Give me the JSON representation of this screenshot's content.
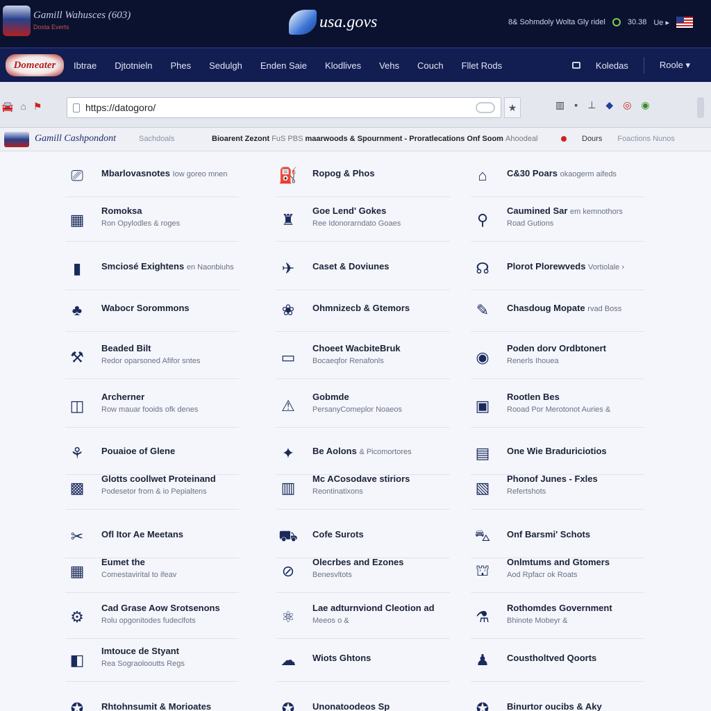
{
  "header": {
    "site_name": "Gamill Wahusces (603)",
    "site_tag": "Dosta Everts",
    "logo_text": "usa.govs",
    "utility_text": "8& Sohmdoly Wolta Gly ridel",
    "time": "30.38",
    "utility_link": "Ue ▸"
  },
  "nav": {
    "logo_text": "Domeater",
    "items": [
      "Ibtrae",
      "Djtotnieln",
      "Phes",
      "Sedulgh",
      "Enden Saie",
      "Klodlives",
      "Vehs",
      "Couch",
      "Fllet Rods"
    ],
    "right_items": [
      "Koledas",
      "Roole ▾"
    ]
  },
  "toolbar": {
    "url": "https://datogoro/",
    "icons": [
      "car-icon",
      "home-icon",
      "flag-icon"
    ],
    "extension_icons": [
      "bars-icon",
      "box-icon",
      "tower-icon",
      "badge-icon",
      "target-icon",
      "globe-icon"
    ]
  },
  "strip": {
    "brand": "Gamill Cashpondont",
    "brand_sub": "Sachdoals",
    "crumb_main": "Bioarent Zezont",
    "crumb_light": "FuS PBS",
    "crumb_rest": "maarwoods & Spournment -",
    "crumb_tail": "Proratlecations Onf Soom",
    "crumb_tail_light": "Ahoodeal",
    "right_label": "Dours",
    "right_light": "Foactions Nunos"
  },
  "entries": [
    {
      "icon": "⎚",
      "title": "Mbarlovasnotes",
      "title_sm": "Iow goreo mnen",
      "sub": ""
    },
    {
      "icon": "⛽",
      "title": "Ropog & Phos",
      "title_sm": "",
      "sub": ""
    },
    {
      "icon": "⌂",
      "title": "C&30 Poars",
      "title_sm": "okaogerm aifeds",
      "sub": ""
    },
    {
      "icon": "▦",
      "title": "Romoksa",
      "title_sm": "",
      "sub": "Ron Opylodles & roges"
    },
    {
      "icon": "♜",
      "title": "Goe Lend' Gokes",
      "title_sm": "",
      "sub": "Ree Idonorarndato Goaes"
    },
    {
      "icon": "⚲",
      "title": "Caumined Sar",
      "title_sm": "em kemnothors",
      "sub": "Road Gutions"
    },
    {
      "icon": "▮",
      "title": "Smciosé Exightens",
      "title_sm": "en Naonbiuhs",
      "sub": ""
    },
    {
      "icon": "✈",
      "title": "Caset & Doviunes",
      "title_sm": "",
      "sub": ""
    },
    {
      "icon": "☊",
      "title": "Plorot Plorewveds",
      "title_sm": "Vortiolale ›",
      "sub": ""
    },
    {
      "icon": "♣",
      "title": "Wabocr Sorommons",
      "title_sm": "",
      "sub": ""
    },
    {
      "icon": "❀",
      "title": "Ohmnizecb & Gtemors",
      "title_sm": "",
      "sub": ""
    },
    {
      "icon": "✎",
      "title": "Chasdoug Mopate",
      "title_sm": "rvad Boss",
      "sub": ""
    },
    {
      "icon": "⚒",
      "title": "Beaded Bilt",
      "title_sm": "",
      "sub": "Redor oparsoned Afifor sntes"
    },
    {
      "icon": "▭",
      "title": "Choeet WacbiteBruk",
      "title_sm": "",
      "sub": "Bocaeqfor Renafonls"
    },
    {
      "icon": "◉",
      "title": "Poden dorv Ordbtonert",
      "title_sm": "",
      "sub": "Renerls Ihouea"
    },
    {
      "icon": "◫",
      "title": "Archerner",
      "title_sm": "",
      "sub": "Row mauar fooids ofk denes"
    },
    {
      "icon": "⚠",
      "title": "Gobmde",
      "title_sm": "",
      "sub": "PersanyComeplor Noaeos"
    },
    {
      "icon": "▣",
      "title": "Rootlen Bes",
      "title_sm": "",
      "sub": "Rooad Por Merotonot Auries &"
    },
    {
      "icon": "⚘",
      "title": "Pouaioe of Glene",
      "title_sm": "",
      "sub": ""
    },
    {
      "icon": "✦",
      "title": "Be Aolons",
      "title_sm": "& Picomortores",
      "sub": ""
    },
    {
      "icon": "▤",
      "title": "One Wie Braduriciotios",
      "title_sm": "",
      "sub": ""
    },
    {
      "icon": "▩",
      "title": "Glotts coollwet Proteinand",
      "title_sm": "",
      "sub": "Podesetor from & io Pepialtens"
    },
    {
      "icon": "▥",
      "title": "Mc ACosodave stiriors",
      "title_sm": "",
      "sub": "Reontinatixons"
    },
    {
      "icon": "▧",
      "title": "Phonof Junes - Fxles",
      "title_sm": "",
      "sub": "Refertshots"
    },
    {
      "icon": "✂",
      "title": "Ofl Itor Ae Meetans",
      "title_sm": "",
      "sub": ""
    },
    {
      "icon": "⛟",
      "title": "Cofe Surots",
      "title_sm": "",
      "sub": ""
    },
    {
      "icon": "⛍",
      "title": "Onf Barsmi' Schots",
      "title_sm": "",
      "sub": ""
    },
    {
      "icon": "▦",
      "title": "Eumet the",
      "title_sm": "",
      "sub": "Comestavirital to ifeav"
    },
    {
      "icon": "⊘",
      "title": "Olecrbes and Ezones",
      "title_sm": "",
      "sub": "Benesvltots"
    },
    {
      "icon": "⛫",
      "title": "Onlmtums and Gtomers",
      "title_sm": "",
      "sub": "Aod Rpfacr ok Roats"
    },
    {
      "icon": "⚙",
      "title": "Cad Grase Aow Srotsenons",
      "title_sm": "",
      "sub": "Rolu opgonitodes fudeclfots"
    },
    {
      "icon": "⚛",
      "title": "Lae adturnviond Cleotion ad",
      "title_sm": "",
      "sub": "Meeos o &"
    },
    {
      "icon": "⚗",
      "title": "Rothomdes Government",
      "title_sm": "",
      "sub": "Bhinote Mobeyr &"
    },
    {
      "icon": "◧",
      "title": "Imtouce de Styant",
      "title_sm": "",
      "sub": "Rea Sograolooutts Regs"
    },
    {
      "icon": "☁",
      "title": "Wiots Ghtons",
      "title_sm": "",
      "sub": ""
    },
    {
      "icon": "♟",
      "title": "Coustholtved Qoorts",
      "title_sm": "",
      "sub": ""
    },
    {
      "icon": "✪",
      "title": "Rhtohnsumit & Morioates",
      "title_sm": "",
      "sub": ""
    },
    {
      "icon": "✪",
      "title": "Unonatoodeos Sp",
      "title_sm": "",
      "sub": ""
    },
    {
      "icon": "✪",
      "title": "Binurtor oucibs & Aky",
      "title_sm": "",
      "sub": ""
    }
  ]
}
